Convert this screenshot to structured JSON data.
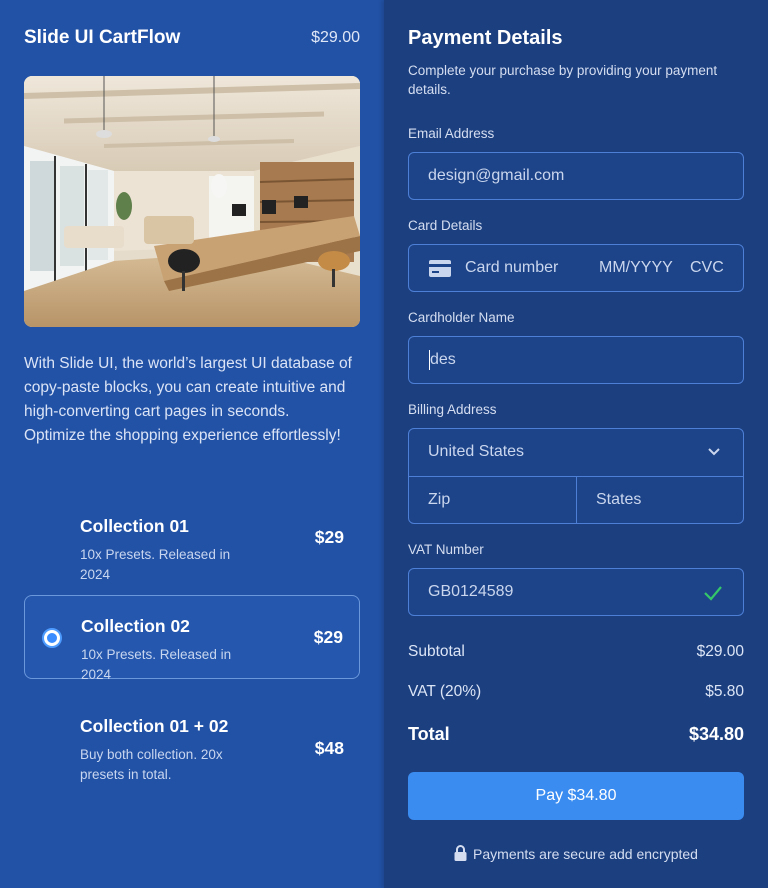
{
  "product": {
    "title": "Slide UI CartFlow",
    "price": "$29.00",
    "image_alt": "Modern open office interior",
    "description": "With Slide UI, the world’s largest UI database of copy-paste blocks, you can create intuitive and high-converting cart pages in seconds. Optimize the shopping experience effortlessly!"
  },
  "options": [
    {
      "title": "Collection 01",
      "subtitle": "10x Presets. Released in 2024",
      "price": "$29",
      "selected": false
    },
    {
      "title": "Collection 02",
      "subtitle": "10x Presets. Released in 2024",
      "price": "$29",
      "selected": true
    },
    {
      "title": "Collection 01 + 02",
      "subtitle": "Buy both collection. 20x presets in total.",
      "price": "$48",
      "selected": false
    }
  ],
  "payment": {
    "title": "Payment Details",
    "subtitle": "Complete your purchase by providing your payment details.",
    "email": {
      "label": "Email Address",
      "value": "design@gmail.com"
    },
    "card": {
      "label": "Card Details",
      "number_placeholder": "Card number",
      "expiry_placeholder": "MM/YYYY",
      "cvc_placeholder": "CVC",
      "icon": "credit-card-icon"
    },
    "cardholder": {
      "label": "Cardholder Name",
      "value": "des"
    },
    "billing": {
      "label": "Billing Address",
      "country": "United States",
      "zip_placeholder": "Zip",
      "state_placeholder": "States"
    },
    "vat": {
      "label": "VAT Number",
      "value": "GB0124589",
      "valid_icon": "checkmark-icon"
    }
  },
  "summary": {
    "subtotal_label": "Subtotal",
    "subtotal": "$29.00",
    "vat_label": "VAT (20%)",
    "vat": "$5.80",
    "total_label": "Total",
    "total": "$34.80"
  },
  "pay_button": "Pay $34.80",
  "secure_note": "Payments are secure add encrypted",
  "colors": {
    "accent": "#3a8cf0",
    "left_bg": "#2252a6",
    "right_bg": "#1c3f7f",
    "valid": "#34c76a"
  }
}
